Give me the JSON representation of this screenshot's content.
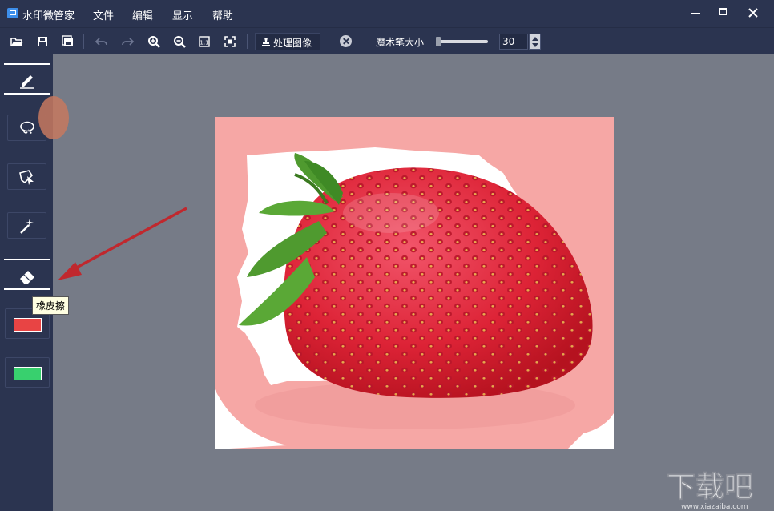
{
  "app": {
    "title": "水印微管家"
  },
  "menu": [
    "文件",
    "编辑",
    "显示",
    "帮助"
  ],
  "toolbar": {
    "process_label": "处理图像",
    "magic_wand_size_label": "魔术笔大小",
    "magic_wand_size_value": "30",
    "magic_wand_slider_fraction": 0.05
  },
  "sidebar": {
    "tooltip": "橡皮擦",
    "foreground_color": "#e84444",
    "background_color": "#38d06e"
  },
  "watermark": {
    "text": "下载吧",
    "url_text": "www.xiazaiba.com"
  },
  "colors": {
    "chrome": "#2b3450",
    "workspace": "#767b87",
    "mask_pink": "#f5a6a6"
  }
}
